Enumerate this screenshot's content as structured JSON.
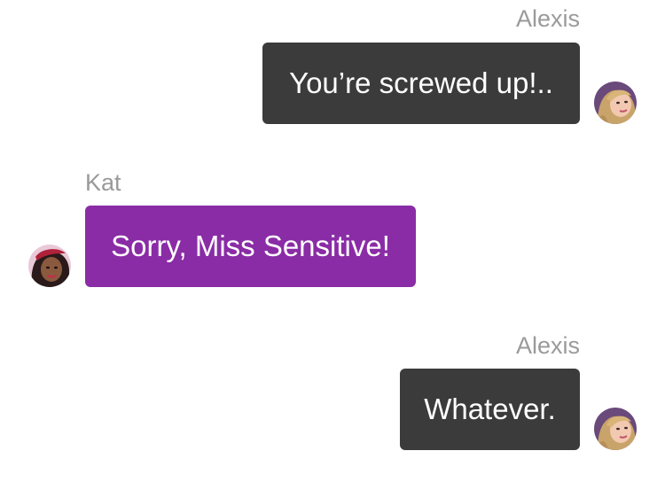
{
  "messages": [
    {
      "sender": "Alexis",
      "text": "You’re screwed up!..",
      "side": "right",
      "bubble_color": "#3b3b3b",
      "avatar_icon": "alexis-avatar-icon"
    },
    {
      "sender": "Kat",
      "text": "Sorry, Miss Sensitive!",
      "side": "left",
      "bubble_color": "#8a2ca6",
      "avatar_icon": "kat-avatar-icon"
    },
    {
      "sender": "Alexis",
      "text": "Whatever.",
      "side": "right",
      "bubble_color": "#3b3b3b",
      "avatar_icon": "alexis-avatar-icon"
    }
  ],
  "colors": {
    "background": "#ffffff",
    "sender_name": "#9a9a9a",
    "outgoing_bubble": "#3b3b3b",
    "incoming_bubble": "#8a2ca6",
    "bubble_text": "#ffffff"
  }
}
